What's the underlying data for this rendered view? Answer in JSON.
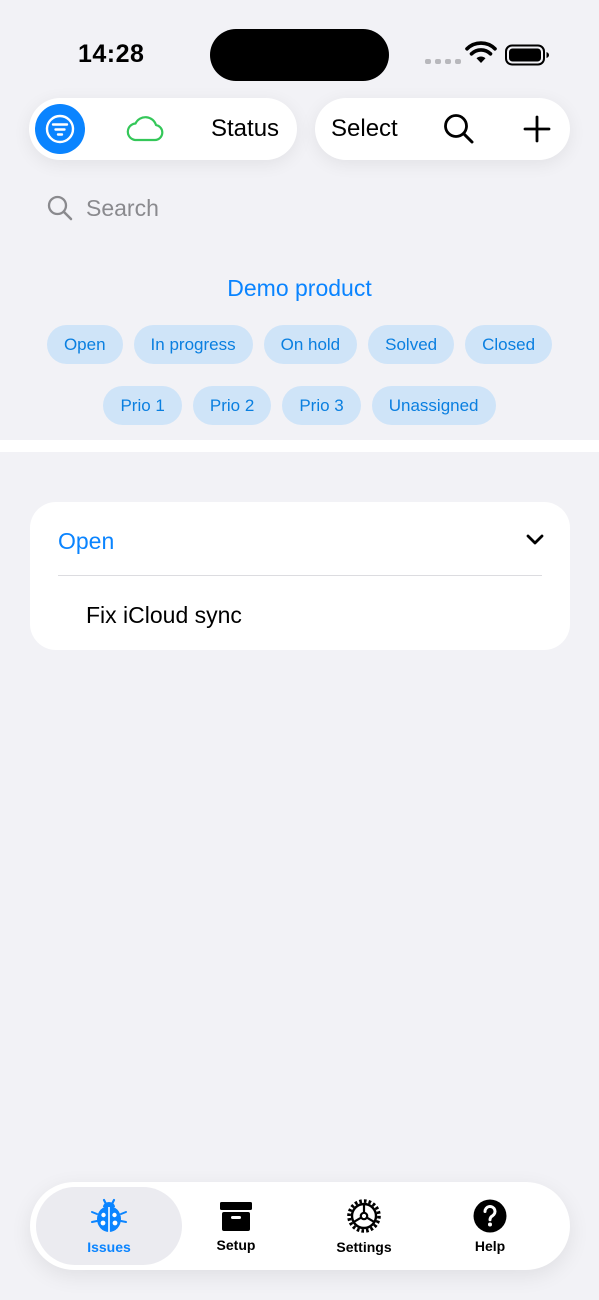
{
  "status_bar": {
    "time": "14:28"
  },
  "toolbar": {
    "filter_icon": "filter-circle-icon",
    "cloud_icon": "cloud-icon",
    "cloud_color": "#34c759",
    "status_label": "Status",
    "select_label": "Select",
    "search_icon": "search-icon",
    "add_icon": "plus-icon"
  },
  "search": {
    "placeholder": "Search"
  },
  "filters": {
    "product": "Demo product",
    "status_chips": [
      "Open",
      "In progress",
      "On hold",
      "Solved",
      "Closed"
    ],
    "priority_chips": [
      "Prio 1",
      "Prio 2",
      "Prio 3",
      "Unassigned"
    ]
  },
  "groups": [
    {
      "title": "Open",
      "expanded": true,
      "issues": [
        {
          "title": "Fix iCloud sync"
        }
      ]
    }
  ],
  "tabs": [
    {
      "label": "Issues",
      "icon": "ladybug-icon",
      "selected": true
    },
    {
      "label": "Setup",
      "icon": "archive-box-icon",
      "selected": false
    },
    {
      "label": "Settings",
      "icon": "gear-icon",
      "selected": false
    },
    {
      "label": "Help",
      "icon": "question-circle-icon",
      "selected": false
    }
  ],
  "colors": {
    "accent": "#0a84ff",
    "chip_bg": "#cfe4f8",
    "background": "#f2f2f6"
  }
}
